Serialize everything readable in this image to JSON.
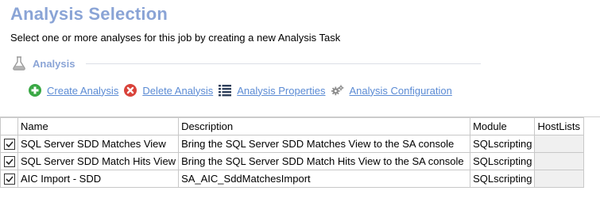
{
  "header": {
    "title": "Analysis Selection",
    "subtitle": "Select one or more analyses for this job by creating a new Analysis Task"
  },
  "group": {
    "label": "Analysis",
    "icon": "flask-icon"
  },
  "toolbar": {
    "create_label": "Create Analysis",
    "delete_label": "Delete Analysis",
    "properties_label": "Analysis Properties",
    "configuration_label": "Analysis Configuration"
  },
  "table": {
    "columns": [
      "",
      "Name",
      "Description",
      "Module",
      "HostLists"
    ],
    "rows": [
      {
        "checked": true,
        "name": "SQL Server SDD Matches View",
        "description": "Bring the SQL Server SDD Matches View to the SA console",
        "module": "SQLscripting",
        "hostlists": ""
      },
      {
        "checked": true,
        "name": "SQL Server SDD Match Hits View",
        "description": "Bring the SQL Server SDD Match Hits View to the SA console",
        "module": "SQLscripting",
        "hostlists": ""
      },
      {
        "checked": true,
        "name": "AIC Import - SDD",
        "description": "SA_AIC_SddMatchesImport",
        "module": "SQLscripting",
        "hostlists": ""
      }
    ]
  },
  "colors": {
    "title": "#8aa4d6",
    "link": "#5b8bd4",
    "create_icon": "#3aa845",
    "delete_icon": "#d9433b"
  }
}
